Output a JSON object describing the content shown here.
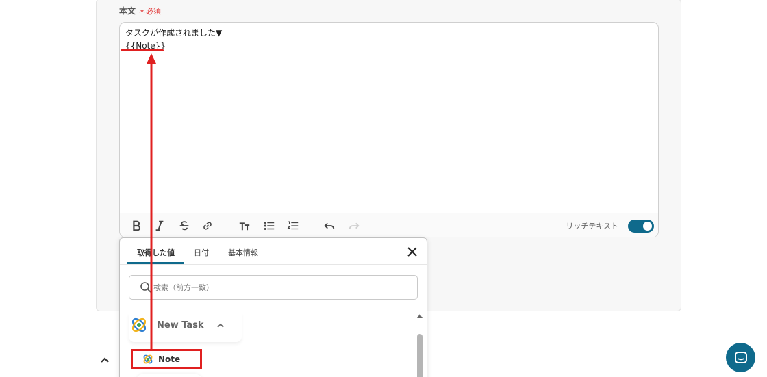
{
  "form": {
    "body_label": "本文",
    "required_mark": "＊必須"
  },
  "editor": {
    "lines": [
      "タスクが作成されました▼",
      "{{Note}}"
    ],
    "rich_text_label": "リッチテキスト",
    "rich_text_enabled": true
  },
  "toolbar": {
    "icons": [
      "bold-icon",
      "italic-icon",
      "strikethrough-icon",
      "link-icon",
      "font-size-icon",
      "bulleted-list-icon",
      "numbered-list-icon",
      "undo-icon",
      "redo-icon"
    ]
  },
  "picker": {
    "tabs": [
      {
        "label": "取得した値",
        "active": true
      },
      {
        "label": "日付",
        "active": false
      },
      {
        "label": "基本情報",
        "active": false
      }
    ],
    "search_placeholder": "検索（前方一致）",
    "group": {
      "title": "New Task",
      "expanded": true
    },
    "items": [
      {
        "label": "Note"
      }
    ]
  },
  "colors": {
    "accent": "#0f6a8c",
    "annotation": "#e02020",
    "required": "#e23c3c"
  }
}
